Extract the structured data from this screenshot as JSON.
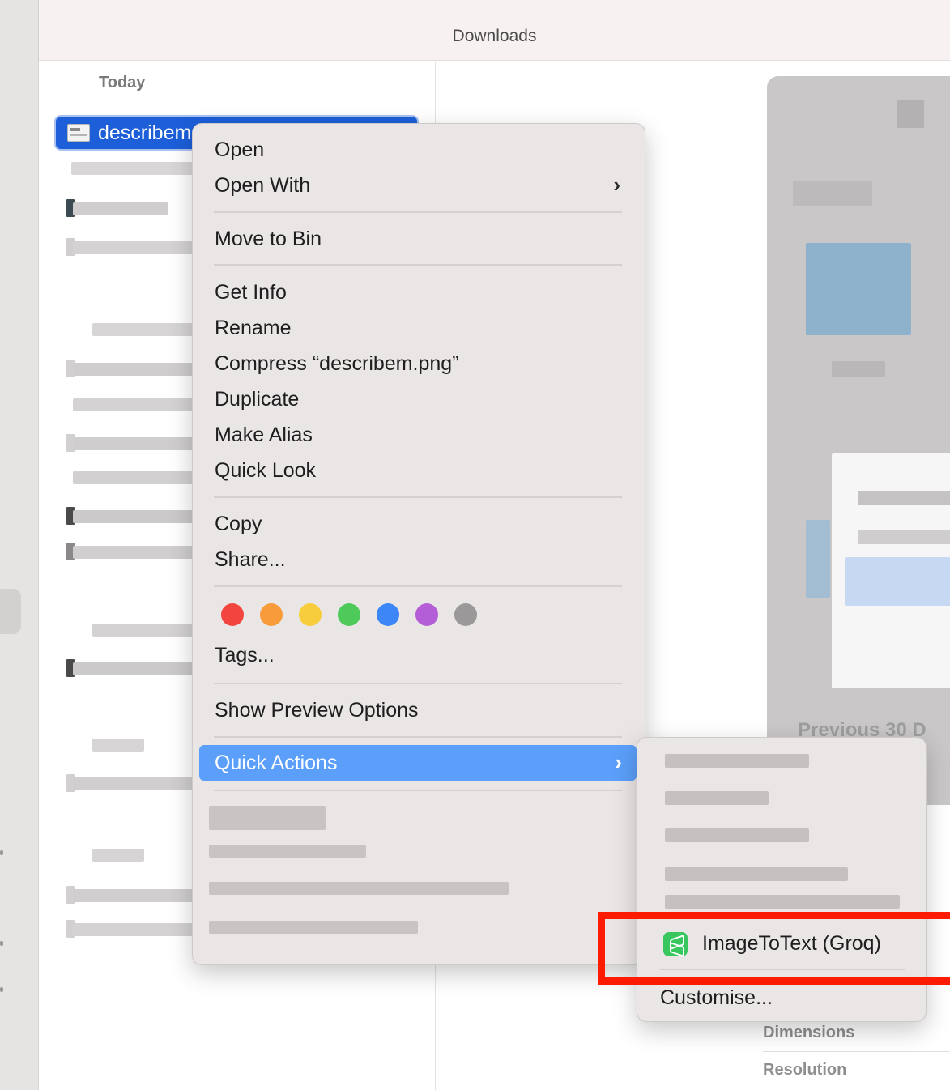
{
  "window": {
    "title": "Downloads"
  },
  "list": {
    "section_header": "Today",
    "selected_file": {
      "name": "describem"
    }
  },
  "context_menu": {
    "items": [
      {
        "label": "Open"
      },
      {
        "label": "Open With"
      },
      {
        "label": "Move to Bin"
      },
      {
        "label": "Get Info"
      },
      {
        "label": "Rename"
      },
      {
        "label": "Compress “describem.png”"
      },
      {
        "label": "Duplicate"
      },
      {
        "label": "Make Alias"
      },
      {
        "label": "Quick Look"
      },
      {
        "label": "Copy"
      },
      {
        "label": "Share..."
      },
      {
        "label": "Tags..."
      },
      {
        "label": "Show Preview Options"
      },
      {
        "label": "Quick Actions"
      }
    ],
    "chevron": "›",
    "tag_colors": [
      {
        "name": "red",
        "color": "#f2453d"
      },
      {
        "name": "orange",
        "color": "#f89c3b"
      },
      {
        "name": "yellow",
        "color": "#f7cd3d"
      },
      {
        "name": "green",
        "color": "#4dca5a"
      },
      {
        "name": "blue",
        "color": "#3d86f7"
      },
      {
        "name": "purple",
        "color": "#b35ed6"
      },
      {
        "name": "gray",
        "color": "#9a9898"
      }
    ]
  },
  "submenu": {
    "action": {
      "label": "ImageToText (Groq)",
      "icon": "shortcuts-icon",
      "icon_color": "#38c65e"
    },
    "customise": "Customise..."
  },
  "preview": {
    "section_label": "Previous 30 D",
    "metadata_labels": [
      "Dimensions",
      "Resolution"
    ]
  },
  "colors": {
    "selection": "#1c5fd9",
    "menu_highlight": "#5b9ffa",
    "annotation": "#ff1b00"
  }
}
